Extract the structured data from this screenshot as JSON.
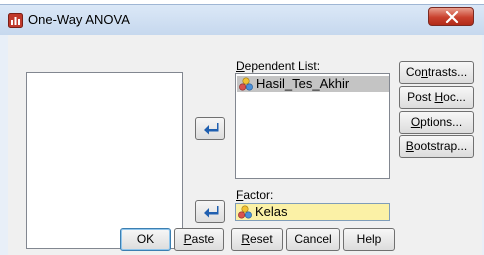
{
  "window": {
    "title": "One-Way ANOVA"
  },
  "dependent": {
    "label_prefix": "D",
    "label_rest": "ependent List:",
    "items": [
      {
        "name": "Hasil_Tes_Akhir"
      }
    ]
  },
  "factor": {
    "label_prefix": "F",
    "label_rest": "actor:",
    "value": "Kelas"
  },
  "side_buttons": {
    "contrasts": {
      "pre": "Co",
      "u": "n",
      "post": "trasts..."
    },
    "post_hoc": {
      "pre": "Post ",
      "u": "H",
      "post": "oc..."
    },
    "options": {
      "pre": "",
      "u": "O",
      "post": "ptions..."
    },
    "bootstrap": {
      "pre": "",
      "u": "B",
      "post": "ootstrap..."
    }
  },
  "bottom_buttons": {
    "ok": {
      "pre": "OK",
      "u": "",
      "post": ""
    },
    "paste": {
      "pre": "",
      "u": "P",
      "post": "aste"
    },
    "reset": {
      "pre": "",
      "u": "R",
      "post": "eset"
    },
    "cancel": {
      "pre": "Cancel",
      "u": "",
      "post": ""
    },
    "help": {
      "pre": "Help",
      "u": "",
      "post": ""
    }
  },
  "colors": {
    "selected_bg": "#c4c4c4",
    "factor_bg": "#fbf1a6",
    "close_red": "#c9412e"
  },
  "icons": {
    "variable": "scale-variable-icon",
    "arrow": "move-left-arrow-icon"
  }
}
